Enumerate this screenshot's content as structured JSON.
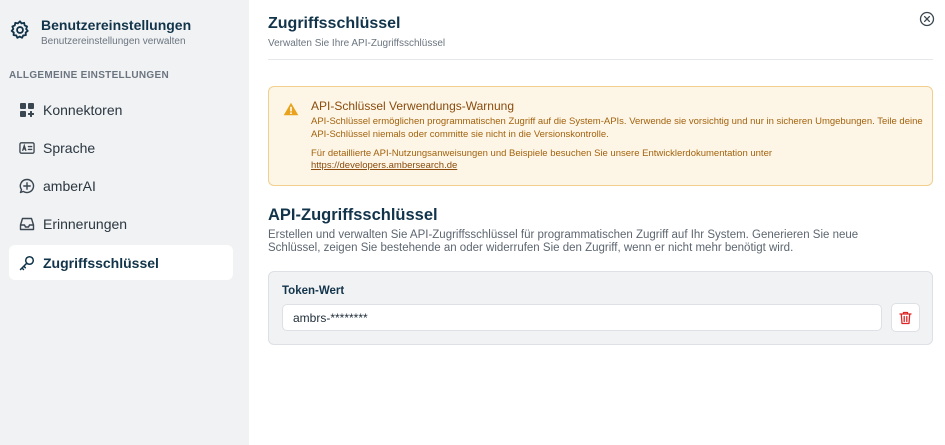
{
  "sidebar": {
    "header": {
      "title": "Benutzereinstellungen",
      "subtitle": "Benutzereinstellungen verwalten",
      "icon": "gear-icon"
    },
    "section_label": "ALLGEMEINE EINSTELLUNGEN",
    "items": [
      {
        "label": "Konnektoren",
        "icon": "grid-plus-icon",
        "active": false
      },
      {
        "label": "Sprache",
        "icon": "language-card-icon",
        "active": false
      },
      {
        "label": "amberAI",
        "icon": "ai-chat-icon",
        "active": false
      },
      {
        "label": "Erinnerungen",
        "icon": "inbox-icon",
        "active": false
      },
      {
        "label": "Zugriffsschlüssel",
        "icon": "key-icon",
        "active": true
      }
    ]
  },
  "main": {
    "title": "Zugriffsschlüssel",
    "subtitle": "Verwalten Sie Ihre API-Zugriffsschlüssel",
    "warning": {
      "title": "API-Schlüssel Verwendungs-Warnung",
      "body": "API-Schlüssel ermöglichen programmatischen Zugriff auf die System-APIs. Verwende sie vorsichtig und nur in sicheren Umgebungen. Teile deine API-Schlüssel niemals oder committe sie nicht in die Versionskontrolle.",
      "link_intro": "Für detaillierte API-Nutzungsanweisungen und Beispiele besuchen Sie unsere Entwicklerdokumentation unter",
      "link_text": "https://developers.ambersearch.de"
    },
    "section": {
      "title": "API-Zugriffsschlüssel",
      "description": "Erstellen und verwalten Sie API-Zugriffsschlüssel für programmatischen Zugriff auf Ihr System. Generieren Sie neue Schlüssel, zeigen Sie bestehende an oder widerrufen Sie den Zugriff, wenn er nicht mehr benötigt wird."
    },
    "token": {
      "label": "Token-Wert",
      "value": "ambrs-********"
    }
  },
  "colors": {
    "sidebar_bg": "#f1f2f4",
    "primary_text": "#12344a",
    "warning_bg": "#fdf6e7",
    "warning_border": "#f0cf8f",
    "warning_text": "#a3620d",
    "danger": "#dc2626"
  }
}
